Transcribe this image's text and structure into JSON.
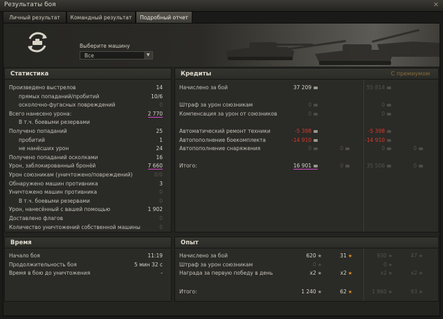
{
  "window": {
    "title": "Результаты боя"
  },
  "tabs": [
    "Личный результат",
    "Командный результат",
    "Подробный отчет"
  ],
  "selector": {
    "label": "Выберите машину",
    "value": "Все"
  },
  "stats": {
    "heading": "Статистика",
    "rows": [
      {
        "label": "Произведено выстрелов",
        "value": "14",
        "indent": false,
        "dim": false,
        "underline": false
      },
      {
        "label": "прямых попаданий/пробитий",
        "value": "10/6",
        "indent": true,
        "dim": false,
        "underline": false
      },
      {
        "label": "осколочно-фугасных повреждений",
        "value": "0",
        "indent": true,
        "dim": true,
        "underline": false
      },
      {
        "label": "Всего нанесено урона:",
        "value": "2 770",
        "indent": false,
        "dim": false,
        "underline": true
      },
      {
        "label": "В т.ч. боевыми резервами",
        "value": "",
        "indent": true,
        "dim": false,
        "underline": false
      },
      {
        "label": "Получено попаданий",
        "value": "25",
        "indent": false,
        "dim": false,
        "underline": false
      },
      {
        "label": "пробитий",
        "value": "1",
        "indent": true,
        "dim": false,
        "underline": false
      },
      {
        "label": "не нанёсших урон",
        "value": "24",
        "indent": true,
        "dim": false,
        "underline": false
      },
      {
        "label": "Получено попаданий осколками",
        "value": "16",
        "indent": false,
        "dim": false,
        "underline": false
      },
      {
        "label": "Урон, заблокированный бронёй",
        "value": "7 660",
        "indent": false,
        "dim": false,
        "underline": true
      },
      {
        "label": "Урон союзникам (уничтожено/повреждений)",
        "value": "0/0",
        "indent": false,
        "dim": true,
        "underline": false
      },
      {
        "label": "Обнаружено машин противника",
        "value": "3",
        "indent": false,
        "dim": false,
        "underline": false
      },
      {
        "label": "Уничтожено машин противника",
        "value": "0",
        "indent": false,
        "dim": true,
        "underline": false
      },
      {
        "label": "В т.ч. боевыми резервами",
        "value": "0",
        "indent": true,
        "dim": true,
        "underline": false
      },
      {
        "label": "Урон, нанесённый с вашей помощью",
        "value": "1 902",
        "indent": false,
        "dim": false,
        "underline": false
      },
      {
        "label": "Доставлено флагов",
        "value": "0",
        "indent": false,
        "dim": true,
        "underline": false
      },
      {
        "label": "Количество уничтожений собственной машины",
        "value": "0",
        "indent": false,
        "dim": true,
        "underline": false
      }
    ]
  },
  "credits": {
    "heading": "Кредиты",
    "premium_label": "С премиумом",
    "rows": [
      {
        "label": "Начислено за бой",
        "a": "37 209",
        "b": "",
        "c": "55 814",
        "d": "",
        "red": false,
        "dimA": false
      },
      {
        "label": "",
        "a": "",
        "b": "",
        "c": "",
        "d": "",
        "red": false,
        "dimA": false
      },
      {
        "label": "Штраф за урон союзникам",
        "a": "0",
        "b": "",
        "c": "0",
        "d": "",
        "red": false,
        "dimA": true
      },
      {
        "label": "Компенсация за урон от союзников",
        "a": "0",
        "b": "",
        "c": "0",
        "d": "",
        "red": false,
        "dimA": true
      },
      {
        "label": "",
        "a": "",
        "b": "",
        "c": "",
        "d": "",
        "red": false,
        "dimA": false
      },
      {
        "label": "Автоматический ремонт техники",
        "a": "-5 398",
        "b": "",
        "c": "-5 398",
        "d": "",
        "red": true,
        "dimA": false
      },
      {
        "label": "Автопополнение боекомплекта",
        "a": "-14 910",
        "b": "",
        "c": "-14 910",
        "d": "",
        "red": true,
        "dimA": false
      },
      {
        "label": "Автопополнение снаряжения",
        "a": "0",
        "b": "0",
        "c": "0",
        "d": "0",
        "red": false,
        "dimA": true
      },
      {
        "label": "",
        "a": "",
        "b": "",
        "c": "",
        "d": "",
        "red": false,
        "dimA": false
      },
      {
        "label": "Итого:",
        "a": "16 901",
        "b": "0",
        "c": "35 506",
        "d": "0",
        "red": false,
        "dimA": false
      }
    ]
  },
  "time": {
    "heading": "Время",
    "rows": [
      {
        "label": "Начало боя",
        "value": "11:19"
      },
      {
        "label": "Продолжительность боя",
        "value": "5 мин 32 с"
      },
      {
        "label": "Время в бою до уничтожения",
        "value": "-"
      }
    ]
  },
  "experience": {
    "heading": "Опыт",
    "rows": [
      {
        "label": "Начислено за бой",
        "a": "620",
        "b": "31",
        "c": "930",
        "d": "47"
      },
      {
        "label": "Штраф за урон союзникам",
        "a": "0",
        "b": "",
        "c": "0",
        "d": ""
      },
      {
        "label": "Награда за первую победу в день",
        "a": "x2",
        "b": "x2",
        "c": "x2",
        "d": "x2"
      },
      {
        "label": "",
        "a": "",
        "b": "",
        "c": "",
        "d": ""
      },
      {
        "label": "Итого:",
        "a": "1 240",
        "b": "62",
        "c": "1 860",
        "d": "93"
      }
    ]
  },
  "colors": {
    "accent_underline": "#d84cc8",
    "negative": "#d83a2a",
    "premium": "#8a6d3c",
    "xp_star": "#e38b2a"
  },
  "icons": [
    "close-icon",
    "vehicle-cycle-icon",
    "dropdown-arrow-icon",
    "credits-icon",
    "free-xp-star-icon",
    "xp-star-icon"
  ]
}
